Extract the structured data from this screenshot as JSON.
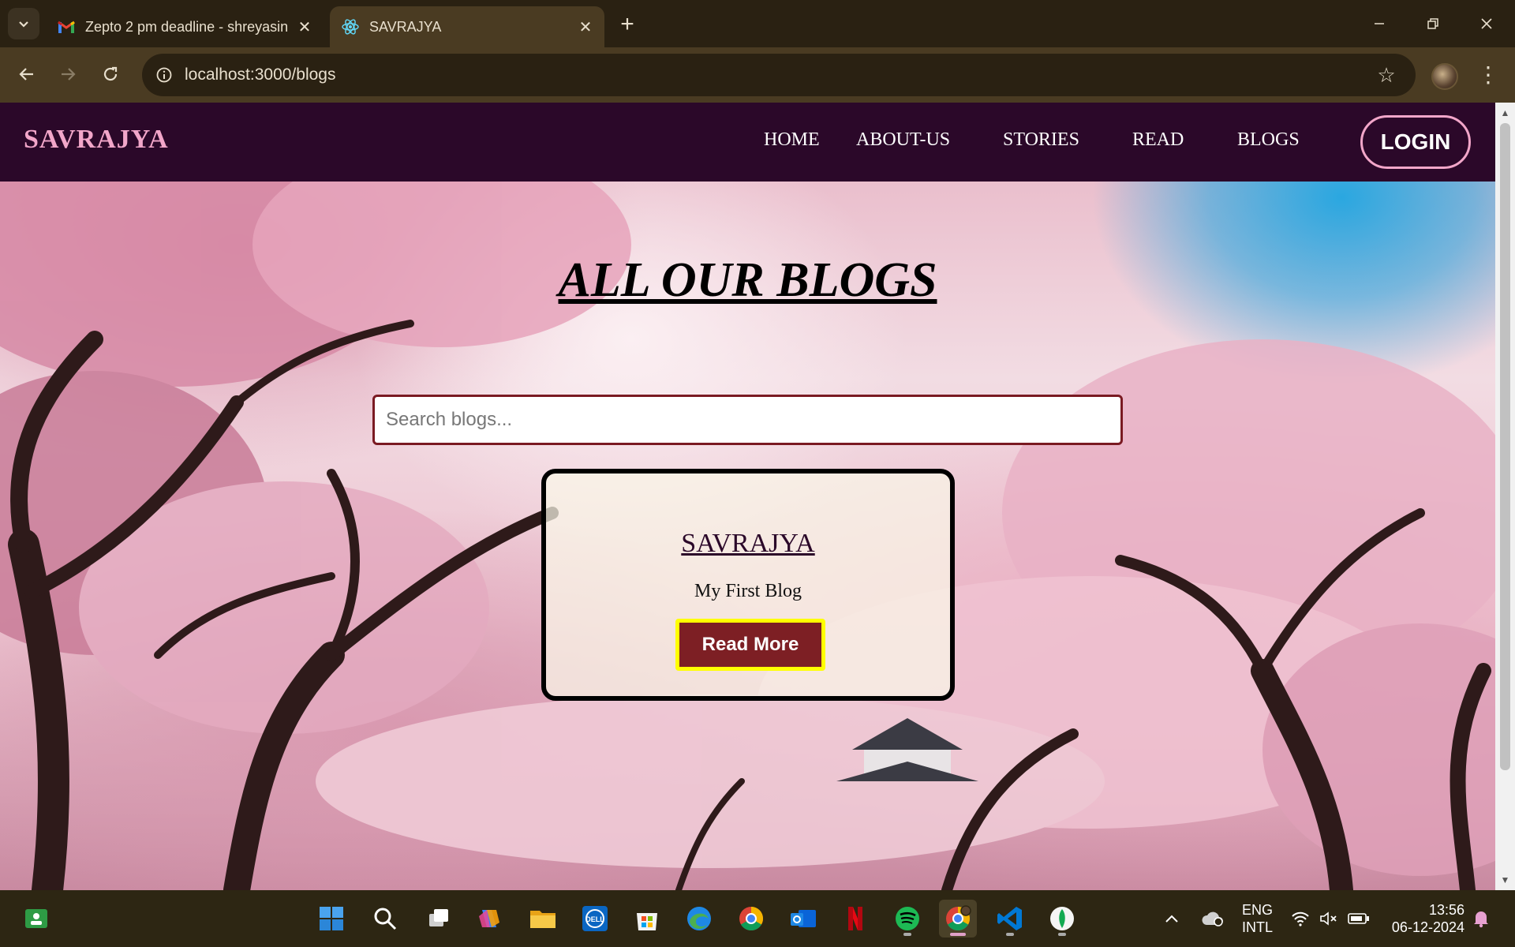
{
  "browser": {
    "tabs": [
      {
        "title": "Zepto 2 pm deadline - shreyasin",
        "active": false,
        "favicon": "gmail-icon"
      },
      {
        "title": "SAVRAJYA",
        "active": true,
        "favicon": "react-icon"
      }
    ],
    "url": "localhost:3000/blogs"
  },
  "site": {
    "brand": "SAVRAJYA",
    "nav": [
      "HOME",
      "ABOUT-US",
      "STORIES",
      "READ",
      "BLOGS"
    ],
    "login_label": "LOGIN",
    "page_title": "ALL OUR BLOGS",
    "search_placeholder": "Search blogs...",
    "blogs": [
      {
        "title": "SAVRAJYA",
        "description": "My First Blog",
        "button": "Read More"
      }
    ]
  },
  "taskbar": {
    "language": [
      "ENG",
      "INTL"
    ],
    "time": "13:56",
    "date": "06-12-2024"
  },
  "colors": {
    "nav_bg": "#2b0829",
    "brand": "#f2a6c9",
    "button_bg": "#7d1f24",
    "button_border": "#ffff00"
  }
}
